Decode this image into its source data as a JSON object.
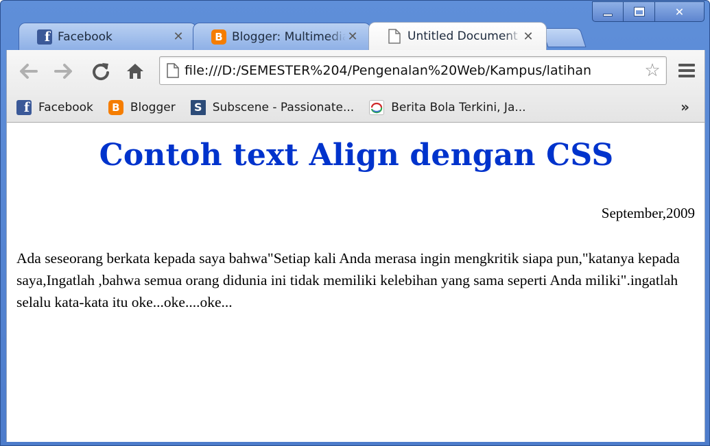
{
  "window": {
    "controls": {
      "minimize": "minimize",
      "maximize": "maximize",
      "close": "✕"
    }
  },
  "tabs": [
    {
      "title": "Facebook",
      "favicon": "facebook-favicon",
      "active": false
    },
    {
      "title": "Blogger: Multimedia",
      "favicon": "blogger-favicon",
      "active": false
    },
    {
      "title": "Untitled Document",
      "favicon": "document-favicon",
      "active": true
    }
  ],
  "toolbar": {
    "url": "file:///D:/SEMESTER%204/Pengenalan%20Web/Kampus/latihan"
  },
  "bookmarks": [
    {
      "label": "Facebook",
      "favicon": "facebook-favicon"
    },
    {
      "label": "Blogger",
      "favicon": "blogger-favicon"
    },
    {
      "label": "Subscene - Passionate...",
      "favicon": "subscene-favicon"
    },
    {
      "label": "Berita Bola Terkini, Ja...",
      "favicon": "berita-bola-favicon"
    }
  ],
  "page": {
    "heading": "Contoh text Align dengan CSS",
    "date": "September,2009",
    "paragraph": "Ada seseorang berkata kepada saya bahwa\"Setiap kali Anda merasa ingin mengkritik siapa pun,\"katanya kepada saya,Ingatlah ,bahwa semua orang didunia ini tidak memiliki kelebihan yang sama seperti Anda miliki\".ingatlah selalu kata-kata itu oke...oke....oke..."
  },
  "colors": {
    "heading": "#0033cc",
    "frame": "#4d7ccb"
  }
}
